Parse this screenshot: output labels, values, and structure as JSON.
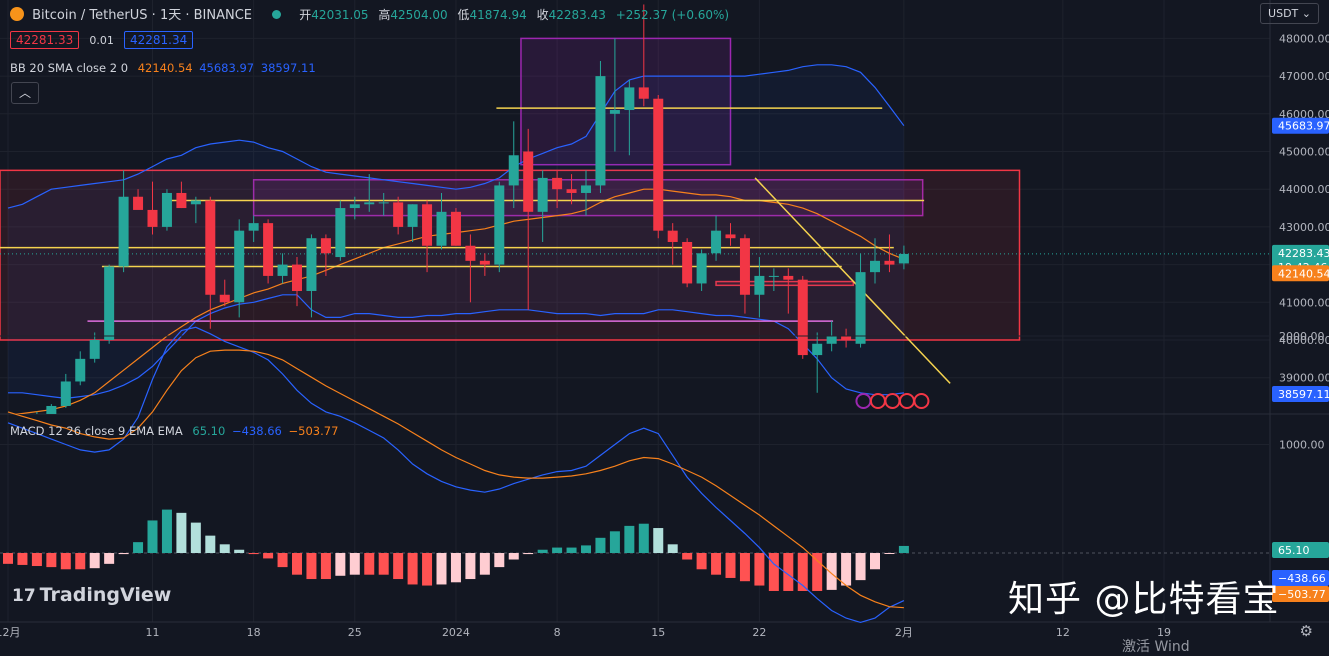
{
  "legend": {
    "symbol": "Bitcoin / TetherUS · 1天 · BINANCE",
    "open_label": "开",
    "open": "42031.05",
    "high_label": "高",
    "high": "42504.00",
    "low_label": "低",
    "low": "41874.94",
    "close_label": "收",
    "close": "42283.43",
    "change": "+252.37 (+0.60%)",
    "sell": "42281.33",
    "spread": "0.01",
    "buy": "42281.34"
  },
  "bb_legend": {
    "name": "BB 20 SMA close 2 0",
    "basis": "42140.54",
    "upper": "45683.97",
    "lower": "38597.11"
  },
  "macd_legend": {
    "name": "MACD 12 26 close 9 EMA EMA",
    "hist": "65.10",
    "macd": "−438.66",
    "signal": "−503.77"
  },
  "currency": "USDT",
  "branding": {
    "logo_text": "TradingView",
    "watermark": "知乎 @比特看宝",
    "bottom_text": "激活 Wind"
  },
  "colors": {
    "up": "#26a69a",
    "down": "#f23645",
    "bb_upper": "#2962ff",
    "bb_basis": "#f7811c",
    "macd": "#2962ff",
    "signal": "#f7811c",
    "zone": "#9c27b0",
    "key_zone": "#f23645",
    "level": "#f5d34f"
  },
  "chart_data": [
    {
      "type": "candlestick",
      "title": "Bitcoin / TetherUS · 1天 · BINANCE",
      "y_ticks": [
        39000,
        40000,
        41000,
        42000,
        43000,
        44000,
        45000,
        46000,
        47000,
        48000
      ],
      "y_tick_labels": [
        "39000.00",
        "40000.00",
        "41000.00",
        "42000.00",
        "43000.00",
        "44000.00",
        "45000.00",
        "46000.00",
        "47000.00",
        "48000.00"
      ],
      "ylim": [
        38600,
        48100
      ],
      "x_tick_labels": [
        {
          "day": 0,
          "label": "12月"
        },
        {
          "day": 10,
          "label": "11"
        },
        {
          "day": 17,
          "label": "18"
        },
        {
          "day": 24,
          "label": "25"
        },
        {
          "day": 31,
          "label": "2024"
        },
        {
          "day": 38,
          "label": "8"
        },
        {
          "day": 45,
          "label": "15"
        },
        {
          "day": 52,
          "label": "22"
        },
        {
          "day": 62,
          "label": "2月"
        },
        {
          "day": 73,
          "label": "12"
        },
        {
          "day": 80,
          "label": "19"
        }
      ],
      "candles": [
        [
          37700,
          38000,
          37600,
          37750
        ],
        [
          37750,
          37900,
          37500,
          37850
        ],
        [
          37850,
          38100,
          37700,
          37900
        ],
        [
          37900,
          38300,
          37800,
          38250
        ],
        [
          38250,
          39100,
          38200,
          38900
        ],
        [
          38900,
          39700,
          38800,
          39500
        ],
        [
          39500,
          40200,
          39400,
          40000
        ],
        [
          40000,
          42000,
          39900,
          41950
        ],
        [
          41950,
          44500,
          41800,
          43800
        ],
        [
          43800,
          44000,
          43500,
          43450
        ],
        [
          43450,
          44200,
          42800,
          43000
        ],
        [
          43000,
          44000,
          42900,
          43900
        ],
        [
          43900,
          44200,
          43500,
          43500
        ],
        [
          43600,
          43800,
          43100,
          43700
        ],
        [
          43700,
          43800,
          40300,
          41200
        ],
        [
          41200,
          41600,
          40900,
          41000
        ],
        [
          41000,
          43200,
          40600,
          42900
        ],
        [
          42900,
          43300,
          42600,
          43100
        ],
        [
          43100,
          43200,
          41500,
          41700
        ],
        [
          41700,
          42300,
          41500,
          42000
        ],
        [
          42000,
          42200,
          40900,
          41300
        ],
        [
          41300,
          42800,
          40600,
          42700
        ],
        [
          42700,
          42800,
          41700,
          42300
        ],
        [
          42200,
          43700,
          42100,
          43500
        ],
        [
          43500,
          43800,
          43200,
          43600
        ],
        [
          43600,
          44400,
          43400,
          43650
        ],
        [
          43650,
          43900,
          43300,
          43650
        ],
        [
          43650,
          43800,
          42800,
          43000
        ],
        [
          43000,
          43600,
          42600,
          43600
        ],
        [
          43600,
          43700,
          41800,
          42500
        ],
        [
          42500,
          43900,
          42400,
          43400
        ],
        [
          43400,
          43500,
          42500,
          42500
        ],
        [
          42500,
          42800,
          41000,
          42100
        ],
        [
          42100,
          42300,
          41700,
          42000
        ],
        [
          42000,
          44200,
          41800,
          44100
        ],
        [
          44100,
          45800,
          43500,
          44900
        ],
        [
          45000,
          45600,
          40800,
          43400
        ],
        [
          43400,
          44500,
          42600,
          44300
        ],
        [
          44300,
          44500,
          43500,
          44000
        ],
        [
          44000,
          44400,
          43600,
          43900
        ],
        [
          43900,
          44500,
          43300,
          44100
        ],
        [
          44100,
          47400,
          43900,
          47000
        ],
        [
          46000,
          48000,
          45000,
          46100
        ],
        [
          46100,
          46900,
          44900,
          46700
        ],
        [
          46700,
          48900,
          46200,
          46400
        ],
        [
          46400,
          46500,
          42700,
          42900
        ],
        [
          42900,
          43100,
          42000,
          42600
        ],
        [
          42600,
          42700,
          41400,
          41500
        ],
        [
          41500,
          42400,
          41300,
          42300
        ],
        [
          42300,
          43300,
          42100,
          42900
        ],
        [
          42800,
          43100,
          42500,
          42700
        ],
        [
          42700,
          42800,
          40700,
          41200
        ],
        [
          41200,
          42200,
          40600,
          41700
        ],
        [
          41700,
          41900,
          41300,
          41700
        ],
        [
          41700,
          41900,
          40700,
          41600
        ],
        [
          41600,
          41700,
          39500,
          39600
        ],
        [
          39600,
          40200,
          38600,
          39900
        ],
        [
          39900,
          40500,
          39700,
          40100
        ],
        [
          40100,
          40300,
          39800,
          40000
        ],
        [
          39900,
          42300,
          39800,
          41800
        ],
        [
          41800,
          42700,
          41500,
          42100
        ],
        [
          42100,
          42800,
          41800,
          42000
        ],
        [
          42031,
          42504,
          41875,
          42283
        ]
      ],
      "bollinger": {
        "upper": [
          43500,
          43600,
          43800,
          44000,
          44050,
          44100,
          44150,
          44200,
          44250,
          44400,
          44600,
          44800,
          44900,
          45100,
          45200,
          45250,
          45300,
          45250,
          45100,
          45000,
          44800,
          44600,
          44450,
          44400,
          44350,
          44300,
          44250,
          44200,
          44150,
          44100,
          44050,
          44000,
          44050,
          44150,
          44300,
          44600,
          44800,
          44950,
          45100,
          45200,
          45400,
          46000,
          46600,
          46900,
          47000,
          47000,
          47000,
          47000,
          47000,
          47000,
          47000,
          47000,
          47050,
          47100,
          47150,
          47250,
          47300,
          47300,
          47250,
          47100,
          46700,
          46200,
          45683.97
        ],
        "basis": [
          38000,
          38050,
          38100,
          38150,
          38250,
          38400,
          38600,
          38900,
          39200,
          39500,
          39800,
          40100,
          40350,
          40600,
          40800,
          40950,
          41100,
          41250,
          41350,
          41500,
          41600,
          41700,
          41850,
          42000,
          42150,
          42300,
          42450,
          42550,
          42650,
          42750,
          42800,
          42850,
          42900,
          42950,
          43050,
          43150,
          43200,
          43250,
          43300,
          43350,
          43450,
          43650,
          43800,
          43900,
          44000,
          44000,
          43950,
          43900,
          43850,
          43850,
          43800,
          43700,
          43700,
          43650,
          43600,
          43500,
          43350,
          43150,
          42950,
          42750,
          42500,
          42300,
          42140.54
        ],
        "lower": [
          38600,
          38600,
          38550,
          38500,
          38450,
          38500,
          38550,
          38650,
          38800,
          39000,
          39300,
          39700,
          40100,
          40500,
          40700,
          40850,
          40950,
          41000,
          41100,
          41200,
          41200,
          40800,
          40600,
          40600,
          40700,
          40700,
          40650,
          40600,
          40600,
          40650,
          40650,
          40700,
          40700,
          40750,
          40800,
          40800,
          40800,
          40750,
          40700,
          40700,
          40700,
          40650,
          40700,
          40700,
          40700,
          40800,
          40800,
          40750,
          40700,
          40650,
          40650,
          40600,
          40550,
          40500,
          40300,
          39900,
          39500,
          39000,
          38700,
          38600,
          38550,
          38550,
          38597.11
        ]
      },
      "zones": [
        {
          "kind": "rectangle",
          "day_from": 17,
          "day_to": 63.3,
          "price_top": 44250,
          "price_bottom": 43300,
          "color": "zone"
        },
        {
          "kind": "rectangle",
          "day_from": 35.5,
          "day_to": 50,
          "price_top": 48000,
          "price_bottom": 44650,
          "color": "zone"
        },
        {
          "kind": "rectangle",
          "day_from": -7,
          "day_to": 70,
          "price_top": 44500,
          "price_bottom": 40000,
          "color": "key_zone"
        },
        {
          "kind": "rectangle",
          "day_from": 49,
          "day_to": 58.5,
          "price_top": 41550,
          "price_bottom": 41450,
          "color": "key_zone"
        }
      ],
      "levels": [
        {
          "day_from": 33.8,
          "day_to": 60.5,
          "price": 46150,
          "color": "level"
        },
        {
          "day_from": 11,
          "day_to": 63.4,
          "price": 43700,
          "color": "level"
        },
        {
          "day_from": -0.6,
          "day_to": 61.3,
          "price": 42450,
          "color": "level"
        },
        {
          "day_from": 6.5,
          "day_to": 57.7,
          "price": 41950,
          "color": "level"
        },
        {
          "day_from": 5.5,
          "day_to": 57.1,
          "price": 40500,
          "color": "zone"
        }
      ],
      "trendline": {
        "day_from": 51.7,
        "price_from": 44300,
        "day_to": 65.2,
        "price_to": 38850
      },
      "price_labels": [
        {
          "value": "45683.97",
          "color": "bb_upper",
          "price": 45683.97
        },
        {
          "value": "42283.43",
          "sub": "19:42:46",
          "color": "up",
          "price": 42283.43
        },
        {
          "value": "42140.54",
          "color": "bb_basis",
          "price": 42140.54
        },
        {
          "value": "38597.11",
          "color": "bb_upper",
          "price": 38597.11
        }
      ]
    },
    {
      "type": "macd",
      "name": "MACD 12 26 close 9 EMA EMA",
      "y_ticks": [
        1000,
        2000
      ],
      "y_tick_labels": [
        "1000.00",
        "2000.00"
      ],
      "ylim": [
        -1050,
        2300
      ],
      "macd": [
        1200,
        1150,
        1100,
        1050,
        1000,
        950,
        930,
        950,
        1050,
        1250,
        1600,
        1900,
        2050,
        2080,
        2020,
        1950,
        1900,
        1850,
        1780,
        1650,
        1500,
        1380,
        1300,
        1260,
        1200,
        1130,
        1060,
        950,
        820,
        730,
        660,
        610,
        580,
        560,
        590,
        640,
        680,
        720,
        750,
        760,
        800,
        900,
        1000,
        1100,
        1150,
        1100,
        900,
        700,
        550,
        420,
        300,
        180,
        50,
        -100,
        -200,
        -300,
        -420,
        -530,
        -600,
        -640,
        -600,
        -500,
        -438.66
      ],
      "signal": [
        1300,
        1260,
        1220,
        1180,
        1150,
        1100,
        1070,
        1050,
        1060,
        1150,
        1300,
        1500,
        1680,
        1800,
        1860,
        1870,
        1870,
        1860,
        1830,
        1780,
        1700,
        1620,
        1540,
        1470,
        1400,
        1330,
        1260,
        1190,
        1110,
        1030,
        950,
        880,
        820,
        760,
        720,
        700,
        690,
        690,
        700,
        710,
        730,
        760,
        800,
        850,
        880,
        870,
        820,
        760,
        700,
        620,
        530,
        440,
        350,
        250,
        150,
        50,
        -70,
        -190,
        -300,
        -390,
        -450,
        -495,
        -503.77
      ],
      "histogram": [
        -100,
        -110,
        -120,
        -130,
        -150,
        -150,
        -140,
        -100,
        -10,
        100,
        300,
        400,
        370,
        280,
        160,
        80,
        30,
        -10,
        -50,
        -130,
        -200,
        -240,
        -240,
        -210,
        -200,
        -200,
        -200,
        -240,
        -290,
        -300,
        -290,
        -270,
        -240,
        -200,
        -130,
        -60,
        -10,
        30,
        50,
        50,
        70,
        140,
        200,
        250,
        270,
        230,
        80,
        -60,
        -150,
        -200,
        -230,
        -260,
        -300,
        -350,
        -350,
        -350,
        -350,
        -340,
        -300,
        -250,
        -150,
        -5,
        65.1
      ],
      "price_labels": [
        {
          "value": "65.10",
          "color": "up",
          "price": 65.1
        },
        {
          "value": "−438.66",
          "color": "bb_upper",
          "price": -438.66
        },
        {
          "value": "−503.77",
          "color": "bb_basis",
          "price": -503.77
        }
      ]
    }
  ]
}
